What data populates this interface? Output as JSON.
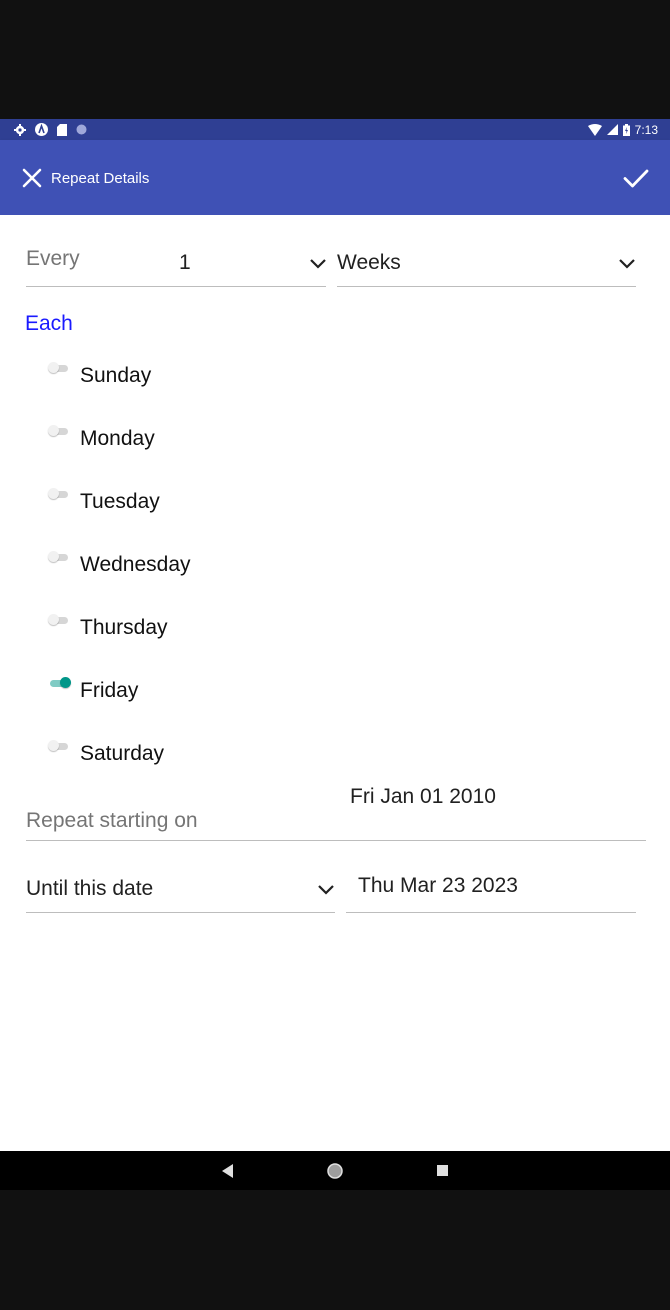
{
  "status_bar": {
    "time": "7:13",
    "left_icons": [
      "settings-icon",
      "a-icon",
      "sd-card-icon",
      "dot-icon"
    ],
    "right_icons": [
      "wifi-icon",
      "signal-icon",
      "battery-icon"
    ]
  },
  "app_bar": {
    "title": "Repeat Details",
    "close_icon": "close-icon",
    "confirm_icon": "check-icon",
    "color": "#3f51b5"
  },
  "frequency": {
    "label": "Every",
    "interval": "1",
    "unit": "Weeks"
  },
  "each": {
    "label": "Each",
    "days": [
      {
        "label": "Sunday",
        "on": false
      },
      {
        "label": "Monday",
        "on": false
      },
      {
        "label": "Tuesday",
        "on": false
      },
      {
        "label": "Wednesday",
        "on": false
      },
      {
        "label": "Thursday",
        "on": false
      },
      {
        "label": "Friday",
        "on": true
      },
      {
        "label": "Saturday",
        "on": false
      }
    ]
  },
  "start": {
    "label": "Repeat starting on",
    "date": "Fri Jan 01 2010"
  },
  "until": {
    "mode": "Until this date",
    "date": "Thu Mar 23 2023"
  },
  "colors": {
    "accent": "#009688",
    "each_label": "#1a1aff"
  },
  "nav_bar": {
    "icons": [
      "back-icon",
      "home-icon",
      "recents-icon"
    ]
  }
}
